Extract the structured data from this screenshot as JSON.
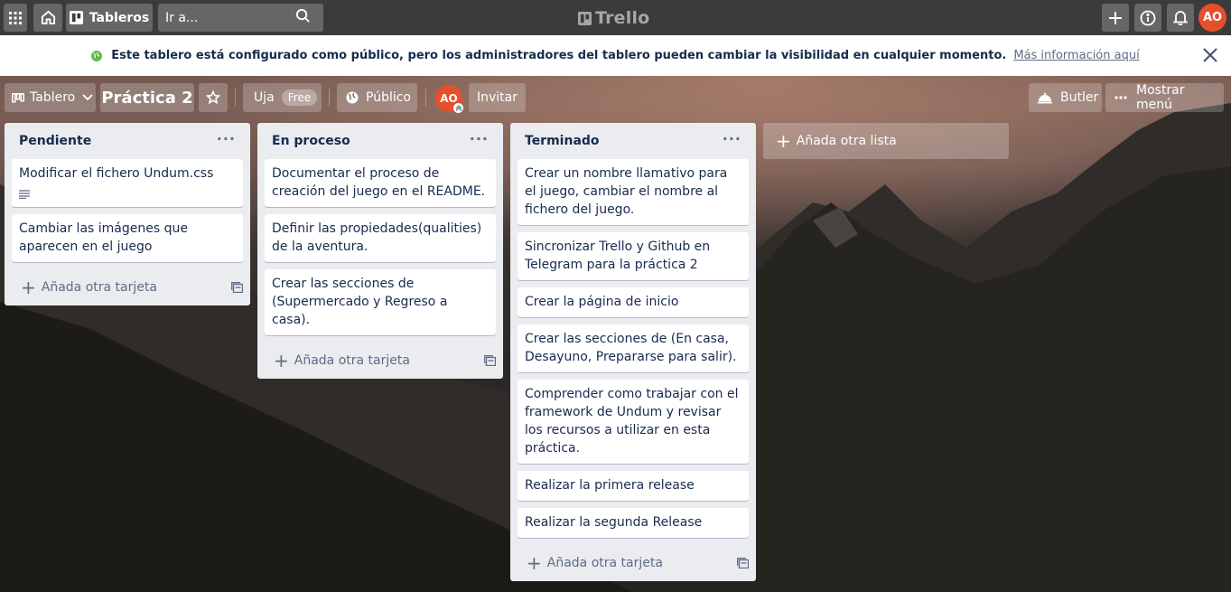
{
  "topbar": {
    "apps_icon": "grid-icon",
    "home_icon": "home-icon",
    "boards_label": "Tableros",
    "search_placeholder": "Ir a...",
    "search_icon": "search-icon",
    "logo_text": "Trello",
    "create_icon": "plus-icon",
    "info_icon": "info-icon",
    "notifications_icon": "bell-icon",
    "avatar_initials": "AO",
    "avatar_color": "#e4502c"
  },
  "notice": {
    "icon": "globe-icon",
    "text": "Este tablero está configurado como público, pero los administradores del tablero pueden cambiar la visibilidad en cualquier momento.",
    "link": "Más información aquí",
    "close_icon": "close-icon"
  },
  "board_header": {
    "view_label": "Tablero",
    "board_name": "Práctica 2",
    "workspace": "Uja",
    "workspace_badge": "Free",
    "visibility": "Público",
    "member_initials": "AO",
    "invite_label": "Invitar",
    "butler_label": "Butler",
    "menu_label": "Mostrar menú"
  },
  "lists": [
    {
      "title": "Pendiente",
      "cards": [
        {
          "title": "Modificar el fichero Undum.css",
          "has_description": true
        },
        {
          "title": "Cambiar las imágenes que aparecen en el juego"
        }
      ],
      "add_card_label": "Añada otra tarjeta"
    },
    {
      "title": "En proceso",
      "cards": [
        {
          "title": "Documentar el proceso de creación del juego en el README."
        },
        {
          "title": "Definir las propiedades(qualities) de la aventura."
        },
        {
          "title": "Crear las secciones de (Supermercado y Regreso a casa)."
        }
      ],
      "add_card_label": "Añada otra tarjeta"
    },
    {
      "title": "Terminado",
      "cards": [
        {
          "title": "Crear un nombre llamativo para el juego, cambiar el nombre al fichero del juego."
        },
        {
          "title": "Sincronizar Trello y Github en Telegram para la práctica 2"
        },
        {
          "title": "Crear la página de inicio"
        },
        {
          "title": "Crear las secciones de (En casa, Desayuno, Prepararse para salir)."
        },
        {
          "title": "Comprender como trabajar con el framework de Undum y revisar los recursos a utilizar en esta práctica."
        },
        {
          "title": "Realizar la primera release"
        },
        {
          "title": "Realizar la segunda Release"
        }
      ],
      "add_card_label": "Añada otra tarjeta"
    }
  ],
  "add_list_label": "Añada otra lista"
}
